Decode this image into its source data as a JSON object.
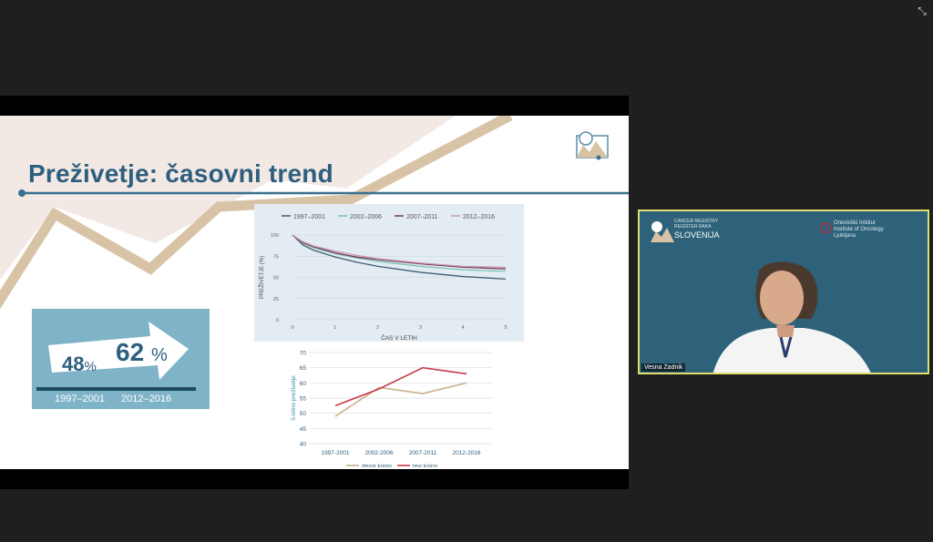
{
  "window": {
    "exit_fullscreen_icon": "exit-fullscreen-icon"
  },
  "slide": {
    "title": "Preživetje: časovni trend",
    "stat_box": {
      "value_left": "48",
      "value_right": "62",
      "percent_sign": "%",
      "year_left": "1997–2001",
      "year_right": "2012–2016"
    }
  },
  "chart_data": [
    {
      "type": "line",
      "legend": [
        "1997–2001",
        "2002–2006",
        "2007–2011",
        "2012–2016"
      ],
      "ylabel": "PREŽIVETJE (%)",
      "xlabel": "ČAS V LETIH",
      "x_ticks": [
        "0",
        "1",
        "2",
        "3",
        "4",
        "5"
      ],
      "y_ticks": [
        "0",
        "25",
        "50",
        "75",
        "100"
      ],
      "xlim": [
        0,
        5
      ],
      "ylim": [
        0,
        100
      ],
      "colors": [
        "#3e5d70",
        "#77c3ae",
        "#7a3955",
        "#c79ab8"
      ],
      "series": [
        {
          "name": "1997–2001",
          "x": [
            0,
            0.25,
            0.5,
            1,
            1.5,
            2,
            3,
            4,
            5
          ],
          "values": [
            100,
            88,
            82,
            74,
            68,
            63,
            56,
            51,
            48
          ]
        },
        {
          "name": "2002–2006",
          "x": [
            0,
            0.25,
            0.5,
            1,
            1.5,
            2,
            3,
            4,
            5
          ],
          "values": [
            100,
            90,
            85,
            78,
            73,
            69,
            63,
            59,
            57
          ]
        },
        {
          "name": "2007–2011",
          "x": [
            0,
            0.25,
            0.5,
            1,
            1.5,
            2,
            3,
            4,
            5
          ],
          "values": [
            100,
            91,
            86,
            79,
            74,
            71,
            66,
            62,
            60
          ]
        },
        {
          "name": "2012–2016",
          "x": [
            0,
            0.25,
            0.5,
            1,
            1.5,
            2,
            3,
            4,
            5
          ],
          "values": [
            100,
            92,
            87,
            81,
            76,
            72,
            67,
            63,
            62
          ]
        }
      ]
    },
    {
      "type": "line",
      "categories": [
        "1997-2001",
        "2002-2006",
        "2007-2011",
        "2012-2016"
      ],
      "ylabel": "5-letno preživetje",
      "y_ticks": [
        "40",
        "45",
        "50",
        "55",
        "60",
        "65",
        "70"
      ],
      "ylim": [
        40,
        70
      ],
      "colors": [
        "#c9b08e",
        "#c93a4a"
      ],
      "series": [
        {
          "name": "desni kolon",
          "values": [
            49,
            58.5,
            56.5,
            60
          ]
        },
        {
          "name": "levi kolon",
          "values": [
            52.5,
            58,
            65,
            63
          ]
        }
      ]
    }
  ],
  "camera": {
    "registry_small": "CANCER REGISTRY\nREGISTER RAKA",
    "registry_big": "SLOVENIJA",
    "institute": "Onkološki Inštitut\nInstitute of Oncology\nLjubljana",
    "participant_name": "Vesna Zadnik",
    "frame_color": "#e0df6e"
  }
}
